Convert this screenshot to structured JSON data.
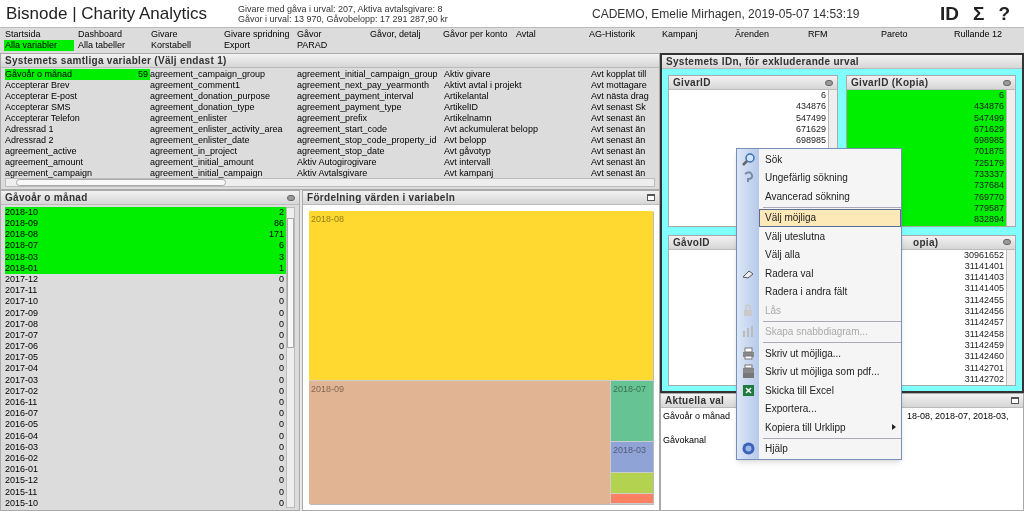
{
  "header": {
    "title": "Bisnode | Charity Analytics",
    "info": [
      "Givare med gåva i urval: 207, Aktiva avtalsgivare: 8",
      "Gåvor i urval: 13 970, Gåvobelopp: 17 291 287,90 kr"
    ],
    "user": "CADEMO, Emelie Mirhagen, 2019-05-07 14:53:19",
    "tools": [
      "ID",
      "Σ",
      "?"
    ]
  },
  "nav": [
    [
      {
        "label": "Startsida",
        "selected": false
      },
      {
        "label": "Dashboard",
        "selected": false
      },
      {
        "label": "Givare",
        "selected": false
      },
      {
        "label": "Givare spridning",
        "selected": false
      },
      {
        "label": "Gåvor",
        "selected": false
      },
      {
        "label": "Gåvor, detalj",
        "selected": false
      },
      {
        "label": "Gåvor per konto",
        "selected": false
      },
      {
        "label": "Avtal",
        "selected": false
      },
      {
        "label": "AG-Historik",
        "selected": false
      },
      {
        "label": "Kampanj",
        "selected": false
      },
      {
        "label": "Ärenden",
        "selected": false
      },
      {
        "label": "RFM",
        "selected": false
      },
      {
        "label": "Pareto",
        "selected": false
      },
      {
        "label": "Rullande 12",
        "selected": false
      }
    ],
    [
      {
        "label": "Alla variabler",
        "selected": true
      },
      {
        "label": "Alla tabeller",
        "selected": false
      },
      {
        "label": "Korstabell",
        "selected": false
      },
      {
        "label": "Export",
        "selected": false
      },
      {
        "label": "PARAD",
        "selected": false
      }
    ]
  ],
  "variables": {
    "title": "Systemets samtliga variabler (Välj endast 1)",
    "columns": [
      [
        {
          "label": "Gåvoår o månad",
          "count": "59",
          "selected": true
        },
        {
          "label": "Accepterar Brev",
          "selected": false
        },
        {
          "label": "Accepterar E-post",
          "selected": false
        },
        {
          "label": "Accepterar SMS",
          "selected": false
        },
        {
          "label": "Accepterar Telefon",
          "selected": false
        },
        {
          "label": "Adressrad 1",
          "selected": false
        },
        {
          "label": "Adressrad 2",
          "selected": false
        },
        {
          "label": "agreement_active",
          "selected": false
        },
        {
          "label": "agreement_amount",
          "selected": false
        },
        {
          "label": "agreement_campaign",
          "selected": false
        }
      ],
      [
        {
          "label": "agreement_campaign_group",
          "selected": false
        },
        {
          "label": "agreement_comment1",
          "selected": false
        },
        {
          "label": "agreement_donation_purpose",
          "selected": false
        },
        {
          "label": "agreement_donation_type",
          "selected": false
        },
        {
          "label": "agreement_enlister",
          "selected": false
        },
        {
          "label": "agreement_enlister_activity_area",
          "selected": false
        },
        {
          "label": "agreement_enlister_date",
          "selected": false
        },
        {
          "label": "agreement_in_project",
          "selected": false
        },
        {
          "label": "agreement_initial_amount",
          "selected": false
        },
        {
          "label": "agreement_initial_campaign",
          "selected": false
        }
      ],
      [
        {
          "label": "agreement_initial_campaign_group",
          "selected": false
        },
        {
          "label": "agreement_next_pay_yearmonth",
          "selected": false
        },
        {
          "label": "agreement_payment_interval",
          "selected": false
        },
        {
          "label": "agreement_payment_type",
          "selected": false
        },
        {
          "label": "agreement_prefix",
          "selected": false
        },
        {
          "label": "agreement_start_code",
          "selected": false
        },
        {
          "label": "agreement_stop_code_property_id",
          "selected": false
        },
        {
          "label": "agreement_stop_date",
          "selected": false
        },
        {
          "label": "Aktiv Autogirogivare",
          "selected": false
        },
        {
          "label": "Aktiv Avtalsgivare",
          "selected": false
        }
      ],
      [
        {
          "label": "Aktiv givare",
          "selected": false
        },
        {
          "label": "Aktivt avtal i projekt",
          "selected": false
        },
        {
          "label": "Artikelantal",
          "selected": false
        },
        {
          "label": "ArtikelID",
          "selected": false
        },
        {
          "label": "Artikelnamn",
          "selected": false
        },
        {
          "label": "Avt ackumulerat belopp",
          "selected": false
        },
        {
          "label": "Avt belopp",
          "selected": false
        },
        {
          "label": "Avt gåvotyp",
          "selected": false
        },
        {
          "label": "Avt intervall",
          "selected": false
        },
        {
          "label": "Avt kampanj",
          "selected": false
        }
      ],
      [
        {
          "label": "Avt kopplat till",
          "selected": false
        },
        {
          "label": "Avt mottagare",
          "selected": false
        },
        {
          "label": "Avt nästa drag",
          "selected": false
        },
        {
          "label": "Avt senast Sk",
          "selected": false
        },
        {
          "label": "Avt senast än",
          "selected": false
        },
        {
          "label": "Avt senast än",
          "selected": false
        },
        {
          "label": "Avt senast än",
          "selected": false
        },
        {
          "label": "Avt senast än",
          "selected": false
        },
        {
          "label": "Avt senast än",
          "selected": false
        },
        {
          "label": "Avt senast än",
          "selected": false
        }
      ]
    ]
  },
  "months": {
    "title": "Gåvoår o månad",
    "items": [
      {
        "label": "2018-10",
        "count": "2",
        "selected": true
      },
      {
        "label": "2018-09",
        "count": "86",
        "selected": true
      },
      {
        "label": "2018-08",
        "count": "171",
        "selected": true
      },
      {
        "label": "2018-07",
        "count": "6",
        "selected": true
      },
      {
        "label": "2018-03",
        "count": "3",
        "selected": true
      },
      {
        "label": "2018-01",
        "count": "1",
        "selected": true
      },
      {
        "label": "2017-12",
        "count": "0",
        "selected": false
      },
      {
        "label": "2017-11",
        "count": "0",
        "selected": false
      },
      {
        "label": "2017-10",
        "count": "0",
        "selected": false
      },
      {
        "label": "2017-09",
        "count": "0",
        "selected": false
      },
      {
        "label": "2017-08",
        "count": "0",
        "selected": false
      },
      {
        "label": "2017-07",
        "count": "0",
        "selected": false
      },
      {
        "label": "2017-06",
        "count": "0",
        "selected": false
      },
      {
        "label": "2017-05",
        "count": "0",
        "selected": false
      },
      {
        "label": "2017-04",
        "count": "0",
        "selected": false
      },
      {
        "label": "2017-03",
        "count": "0",
        "selected": false
      },
      {
        "label": "2017-02",
        "count": "0",
        "selected": false
      },
      {
        "label": "2016-11",
        "count": "0",
        "selected": false
      },
      {
        "label": "2016-07",
        "count": "0",
        "selected": false
      },
      {
        "label": "2016-05",
        "count": "0",
        "selected": false
      },
      {
        "label": "2016-04",
        "count": "0",
        "selected": false
      },
      {
        "label": "2016-03",
        "count": "0",
        "selected": false
      },
      {
        "label": "2016-02",
        "count": "0",
        "selected": false
      },
      {
        "label": "2016-01",
        "count": "0",
        "selected": false
      },
      {
        "label": "2015-12",
        "count": "0",
        "selected": false
      },
      {
        "label": "2015-11",
        "count": "0",
        "selected": false
      },
      {
        "label": "2015-10",
        "count": "0",
        "selected": false
      }
    ]
  },
  "treemap": {
    "title": "Fördelning värden i variabeln",
    "tiles": [
      {
        "label": "2018-08",
        "color": "#ffd92f"
      },
      {
        "label": "2018-09",
        "color": "#e1b493"
      },
      {
        "label": "2018-07",
        "color": "#66c494"
      },
      {
        "label": "2018-03",
        "color": "#8fa3d6"
      },
      {
        "color": "#b3d350"
      },
      {
        "color": "#fc8062"
      }
    ]
  },
  "ids": {
    "title": "Systemets IDn, för exkluderande urval",
    "lists": [
      {
        "title": "GivarID",
        "selected": false,
        "values": [
          "6",
          "434876",
          "547499",
          "671629",
          "698985"
        ]
      },
      {
        "title": "GivarID (Kopia)",
        "selected": true,
        "values": [
          "6",
          "434876",
          "547499",
          "671629",
          "698985",
          "701875",
          "725179",
          "733337",
          "737684",
          "769770",
          "779587",
          "832894"
        ]
      },
      {
        "title": "GåvoID",
        "selected": false
      },
      {
        "title": "opia)",
        "selected": false,
        "values": [
          "30961652",
          "31141401",
          "31141403",
          "31141405",
          "31142455",
          "31142456",
          "31142457",
          "31142458",
          "31142459",
          "31142460",
          "31142701",
          "31142702"
        ]
      }
    ]
  },
  "current": {
    "title": "Aktuella val",
    "rows": [
      {
        "field": "Gåvoår o månad",
        "value": "18-08, 2018-07, 2018-03,"
      },
      {
        "field": "Gåvokanal"
      }
    ]
  },
  "menu": [
    {
      "kind": "item",
      "label": "Sök",
      "selected": false,
      "disabled": false
    },
    {
      "kind": "item",
      "label": "Ungefärlig sökning",
      "selected": false,
      "disabled": false
    },
    {
      "kind": "item",
      "label": "Avancerad sökning",
      "selected": false,
      "disabled": false
    },
    {
      "kind": "separator"
    },
    {
      "kind": "item",
      "label": "Välj möjliga",
      "selected": true,
      "disabled": false
    },
    {
      "kind": "item",
      "label": "Välj uteslutna",
      "selected": false,
      "disabled": false
    },
    {
      "kind": "item",
      "label": "Välj alla",
      "selected": false,
      "disabled": false
    },
    {
      "kind": "item",
      "label": "Radera val",
      "selected": false,
      "disabled": false
    },
    {
      "kind": "item",
      "label": "Radera i andra fält",
      "selected": false,
      "disabled": false
    },
    {
      "kind": "item",
      "label": "Lås",
      "selected": false,
      "disabled": true
    },
    {
      "kind": "separator"
    },
    {
      "kind": "item",
      "label": "Skapa snabbdiagram...",
      "selected": false,
      "disabled": true
    },
    {
      "kind": "separator"
    },
    {
      "kind": "item",
      "label": "Skriv ut möjliga...",
      "selected": false,
      "disabled": false
    },
    {
      "kind": "item",
      "label": "Skriv ut möjliga som pdf...",
      "selected": false,
      "disabled": false
    },
    {
      "kind": "item",
      "label": "Skicka till Excel",
      "selected": false,
      "disabled": false
    },
    {
      "kind": "item",
      "label": "Exportera...",
      "selected": false,
      "disabled": false
    },
    {
      "kind": "submenu",
      "label": "Kopiera till Urklipp",
      "selected": false,
      "disabled": false
    },
    {
      "kind": "separator"
    },
    {
      "kind": "item",
      "label": "Hjälp",
      "selected": false,
      "disabled": false
    }
  ]
}
